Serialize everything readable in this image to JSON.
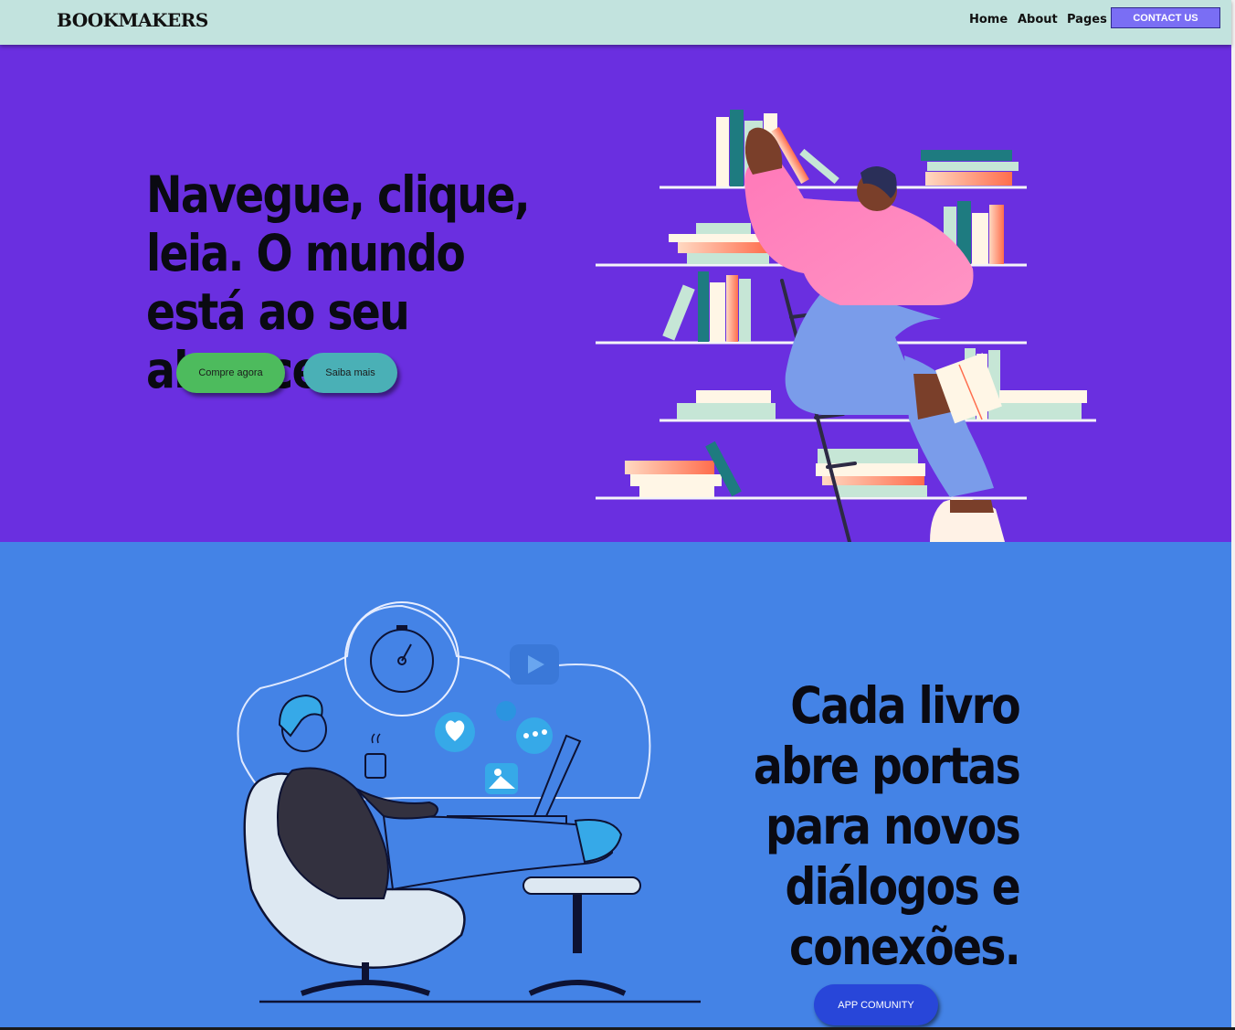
{
  "nav": {
    "logo": "BOOKMAKERS",
    "links": [
      "Home",
      "About",
      "Pages"
    ],
    "contact": "CONTACT US"
  },
  "hero": {
    "title": "Navegue, clique, leia. O mundo está ao seu alcance",
    "buy_button": "Compre agora",
    "learn_button": "Saiba mais"
  },
  "community": {
    "title": "Cada livro abre portas para novos diálogos e conexões.",
    "button": "APP COMUNITY"
  },
  "colors": {
    "nav_bg": "#c2e3de",
    "hero_bg": "#6a2fe0",
    "section_bg": "#4483e6",
    "contact_bg": "#7a6ef4",
    "buy_bg": "#4dbb5d",
    "learn_bg": "#4ab0b6",
    "app_bg": "#2846d9"
  },
  "icons": [
    "clock-icon",
    "heart-icon",
    "chat-icon",
    "play-icon",
    "image-icon",
    "coffee-icon"
  ]
}
